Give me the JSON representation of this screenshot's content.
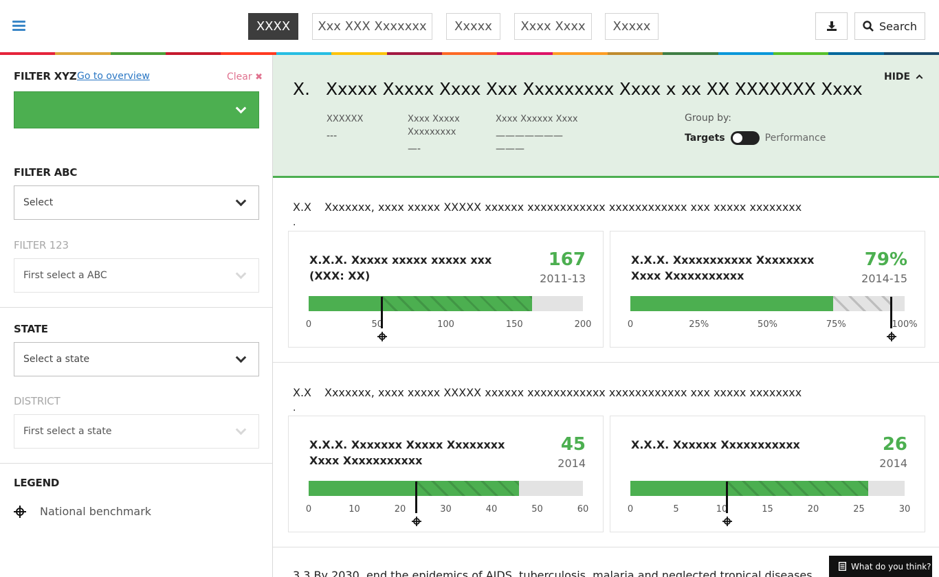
{
  "header": {
    "nav": [
      {
        "label": "XXXX",
        "active": true
      },
      {
        "label": "Xxx XXX Xxxxxxx"
      },
      {
        "label": "Xxxxx"
      },
      {
        "label": "Xxxx Xxxx"
      },
      {
        "label": "Xxxxx"
      }
    ],
    "download_icon": "download-icon",
    "search_label": "Search",
    "stripe_colors": [
      "#e5243b",
      "#dda63a",
      "#4c9f38",
      "#c5192d",
      "#ff3a21",
      "#26bde2",
      "#fcc30b",
      "#a21942",
      "#fd6925",
      "#dd1367",
      "#fd9d24",
      "#bf8b2e",
      "#3f7e44",
      "#0a97d9",
      "#56c02b",
      "#00689d",
      "#19486a"
    ]
  },
  "sidebar": {
    "filter_xyz": {
      "label": "FILTER XYZ",
      "link": "Go to overview",
      "clear": "Clear"
    },
    "filter_abc": {
      "label": "FILTER ABC",
      "value": "Select"
    },
    "filter_123": {
      "label": "FILTER 123",
      "value": "First select a ABC"
    },
    "state": {
      "label": "STATE",
      "value": "Select a state"
    },
    "district": {
      "label": "DISTRICT",
      "value": "First select a state"
    },
    "legend": {
      "label": "LEGEND",
      "item": "National benchmark",
      "icon": "benchmark-crosshair-icon"
    }
  },
  "goal": {
    "number": "X.",
    "title": "Xxxxx Xxxxx Xxxx Xxx Xxxxxxxxx Xxxx x  xx XX XXXXXXX Xxxx",
    "hide": "HIDE",
    "meta": [
      {
        "label": "XXXXXX",
        "value": "---"
      },
      {
        "label": "Xxxx Xxxxx Xxxxxxxxx",
        "value": "—-"
      },
      {
        "label": "Xxxx Xxxxxx Xxxx",
        "value": "———————\n———"
      }
    ],
    "group_by": "Group by:",
    "toggle_left": "Targets",
    "toggle_right": "Performance"
  },
  "targets": [
    {
      "number": "X.X",
      "dot": ".",
      "text": "Xxxxxxx, xxxx xxxxx XXXXX xxxxxx xxxxxxxxxxxx xxxxxxxxxxxx xxx xxxxx xxxxxxxx",
      "indicators": [
        {
          "title": "X.X.X. Xxxxx xxxxx xxxxx xxx (XXX: XX)",
          "value": "167",
          "year": "2011-13",
          "min": 0,
          "max": 200,
          "current": 163,
          "benchmark": 53,
          "ticks": [
            {
              "v": 0,
              "t": "0"
            },
            {
              "v": 50,
              "t": "50"
            },
            {
              "v": 100,
              "t": "100"
            },
            {
              "v": 150,
              "t": "150"
            },
            {
              "v": 200,
              "t": "200"
            }
          ]
        },
        {
          "title": "X.X.X. Xxxxxxxxxxx Xxxxxxxx Xxxx Xxxxxxxxxxx",
          "value": "79%",
          "year": "2014-15",
          "min": 0,
          "max": 100,
          "current": 74,
          "benchmark": 95,
          "light_hatch": true,
          "ticks": [
            {
              "v": 0,
              "t": "0"
            },
            {
              "v": 25,
              "t": "25%"
            },
            {
              "v": 50,
              "t": "50%"
            },
            {
              "v": 75,
              "t": "75%"
            },
            {
              "v": 100,
              "t": "100%"
            }
          ]
        }
      ]
    },
    {
      "number": "X.X",
      "dot": ".",
      "text": "Xxxxxxx, xxxx xxxxx XXXXX xxxxxx xxxxxxxxxxxx xxxxxxxxxxxx xxx xxxxx xxxxxxxx",
      "indicators": [
        {
          "title": "X.X.X. Xxxxxxx Xxxxx Xxxxxxxx Xxxx Xxxxxxxxxxx",
          "value": "45",
          "year": "2014",
          "min": 0,
          "max": 60,
          "current": 46,
          "benchmark": 23.5,
          "ticks": [
            {
              "v": 0,
              "t": "0"
            },
            {
              "v": 10,
              "t": "10"
            },
            {
              "v": 20,
              "t": "20"
            },
            {
              "v": 30,
              "t": "30"
            },
            {
              "v": 40,
              "t": "40"
            },
            {
              "v": 50,
              "t": "50"
            },
            {
              "v": 60,
              "t": "60"
            }
          ]
        },
        {
          "title": "X.X.X. Xxxxxx Xxxxxxxxxxx",
          "value": "26",
          "year": "2014",
          "min": 0,
          "max": 30,
          "current": 26,
          "benchmark": 10.5,
          "ticks": [
            {
              "v": 0,
              "t": "0"
            },
            {
              "v": 5,
              "t": "5"
            },
            {
              "v": 10,
              "t": "10"
            },
            {
              "v": 15,
              "t": "15"
            },
            {
              "v": 20,
              "t": "20"
            },
            {
              "v": 25,
              "t": "25"
            },
            {
              "v": 30,
              "t": "30"
            }
          ]
        }
      ]
    }
  ],
  "partial_target": "3.3   By 2030, end the epidemics of AIDS, tuberculosis, malaria and neglected tropical diseases",
  "feedback": {
    "label": "What do you think?",
    "icon": "document-icon"
  }
}
